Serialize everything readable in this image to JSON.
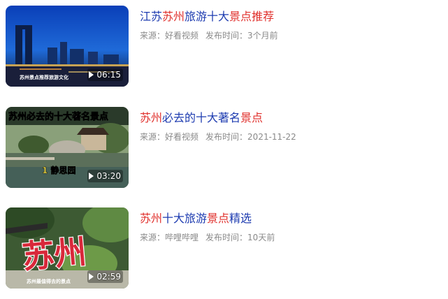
{
  "results": [
    {
      "title_parts": [
        {
          "text": "江苏",
          "highlight": false
        },
        {
          "text": "苏州",
          "highlight": true
        },
        {
          "text": "旅游十大",
          "highlight": false
        },
        {
          "text": "景点",
          "highlight": true
        },
        {
          "text": "推荐",
          "highlight": true
        }
      ],
      "source_label": "来源：",
      "source": "好看视频",
      "time_label": "发布时间：",
      "time": "3个月前",
      "duration": "06:15",
      "thumb_caption": "苏州景点推荐旅游文化"
    },
    {
      "title_parts": [
        {
          "text": "苏州",
          "highlight": true
        },
        {
          "text": "必去的十大著名",
          "highlight": false
        },
        {
          "text": "景点",
          "highlight": true
        }
      ],
      "source_label": "来源：",
      "source": "好看视频",
      "time_label": "发布时间：",
      "time": "2021-11-22",
      "duration": "03:20",
      "thumb_caption": "苏州必去的十大著名景点",
      "thumb_subcaption": "1 静思园"
    },
    {
      "title_parts": [
        {
          "text": "苏州",
          "highlight": true
        },
        {
          "text": "十大旅游",
          "highlight": false
        },
        {
          "text": "景点",
          "highlight": true
        },
        {
          "text": "精选",
          "highlight": false
        }
      ],
      "source_label": "来源：",
      "source": "哔哩哔哩",
      "time_label": "发布时间：",
      "time": "10天前",
      "duration": "02:59",
      "thumb_caption": "苏州",
      "thumb_subcaption": "苏州最值得去的景点"
    }
  ],
  "colors": {
    "title": "#1d3bb0",
    "highlight": "#e0302c",
    "meta": "#8a8a8a"
  }
}
